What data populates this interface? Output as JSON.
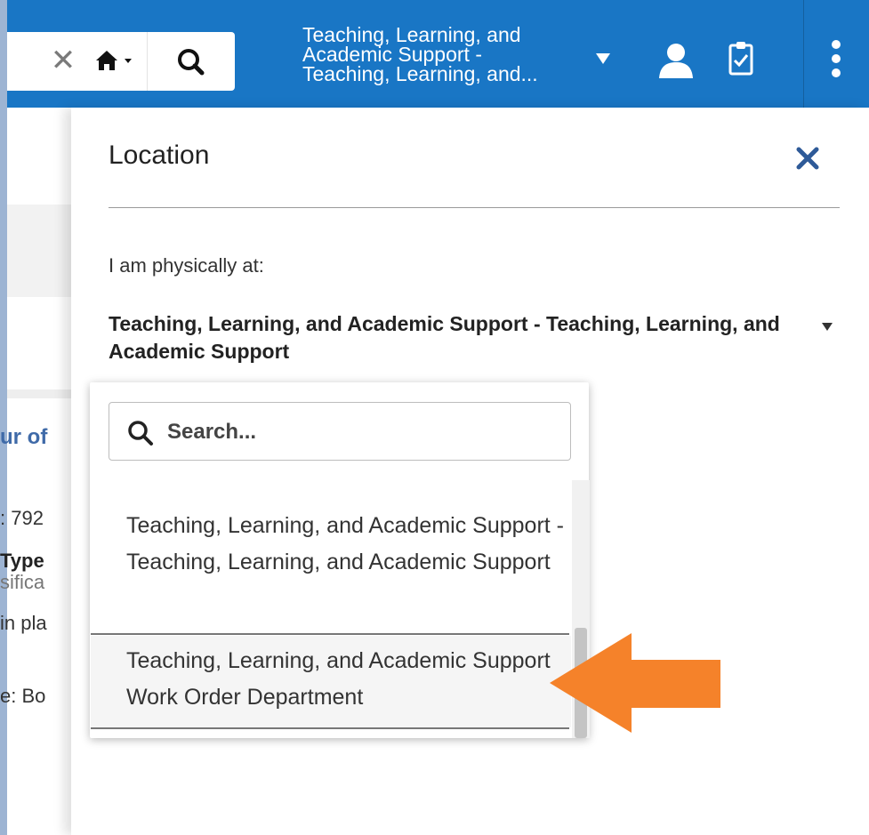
{
  "header": {
    "clear_label": "✕",
    "location_title": "Teaching, Learning, and Academic Support - Teaching, Learning, and..."
  },
  "background": {
    "fragments": [
      "ur of",
      ": 792",
      "Type",
      "sifica",
      "in pla",
      "e: Bo"
    ]
  },
  "panel": {
    "title": "Location",
    "label": "I am physically at:",
    "selected_value": "Teaching, Learning, and Academic Support - Teaching, Learning, and Academic Support"
  },
  "dropdown": {
    "search_placeholder": "Search...",
    "options": [
      "Teaching, Learning, and Academic Support - Teaching, Learning, and Academic Support",
      "Teaching, Learning, and Academic Support Work Order Department"
    ]
  },
  "colors": {
    "header_bg": "#1976c5",
    "close_icon": "#2e5a98",
    "arrow": "#f5822a"
  },
  "icons": {
    "clear": "close-icon",
    "home": "home-icon",
    "search": "search-icon",
    "caret": "caret-down-icon",
    "user": "user-icon",
    "tasks": "clipboard-check-icon",
    "more": "more-vertical-icon",
    "panel_close": "close-icon"
  }
}
